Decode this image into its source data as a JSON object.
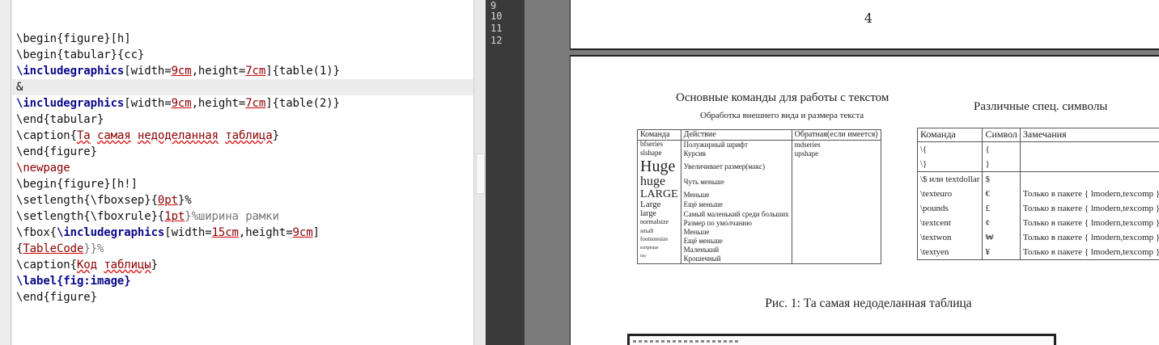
{
  "editor": {
    "lines": [
      [
        "\\begin{figure}[h]"
      ],
      [
        "\\begin{tabular}{cc}"
      ],
      [
        "\\includegraphics",
        "[width=",
        "9cm",
        ",height=",
        "7cm",
        "]{table(1)}"
      ],
      [
        "&"
      ],
      [
        "\\includegraphics",
        "[width=",
        "9cm",
        ",height=",
        "7cm",
        "]{table(2)}"
      ],
      [
        "\\end{tabular}"
      ],
      [
        "\\caption{",
        "Та",
        " ",
        "самая",
        " ",
        "недоделанная",
        " ",
        "таблица",
        "}"
      ],
      [
        "\\end{figure}"
      ],
      [
        "\\newpage"
      ],
      [
        "\\begin{figure}[h!]"
      ],
      [
        "\\setlength{\\fboxsep}{",
        "0pt",
        "}%"
      ],
      [
        "\\setlength{\\fboxrule}{",
        "1pt",
        "}%ширина рамки"
      ],
      [
        "\\fbox{",
        "\\includegraphics",
        "[width=",
        "15cm",
        ",height=",
        "9cm",
        "]"
      ],
      [
        "{",
        "TableCode",
        "}}%"
      ],
      [
        "\\caption{",
        "Код",
        " ",
        "таблицы",
        "}"
      ],
      [
        "\\label{fig:image}"
      ],
      [
        "\\end{figure}"
      ]
    ]
  },
  "console": {
    "line_numbers": [
      "9",
      "10",
      "11",
      "12"
    ]
  },
  "preview": {
    "page_number": "4",
    "table1": {
      "title": "Основные команды для работы с текстом",
      "subtitle": "Обработка внешнего вида и размера текста",
      "headers": [
        "Команда",
        "Действие",
        "Обратная(если имеется)"
      ],
      "rows": [
        [
          "bfseries",
          "Полужирный шрифт",
          "mdseries"
        ],
        [
          "slshape",
          "Курсив",
          "upshape"
        ],
        [
          "Huge",
          "Увеличивает размер(макс)",
          ""
        ],
        [
          "huge",
          "Чуть меньше",
          ""
        ],
        [
          "LARGE",
          "Меньше",
          ""
        ],
        [
          "Large",
          "Ещё меньше",
          ""
        ],
        [
          "large",
          "Самый маленький среди больших",
          ""
        ],
        [
          "normalsize",
          "Размер по умолчанию",
          ""
        ],
        [
          "small",
          "Меньше",
          ""
        ],
        [
          "footnotesize",
          "Ещё меньше",
          ""
        ],
        [
          "scriptsize",
          "Маленький",
          ""
        ],
        [
          "tiny",
          "Крошечный",
          ""
        ]
      ]
    },
    "table2": {
      "title": "Различные спец. символы",
      "headers": [
        "Команда",
        "Символ",
        "Замечания"
      ],
      "rows": [
        [
          "\\{",
          "{",
          ""
        ],
        [
          "\\}",
          "}",
          ""
        ],
        [
          "\\$ или textdollar",
          "$",
          ""
        ],
        [
          "\\texteuro",
          "€",
          "Только в пакете { lmodern,texcomp }"
        ],
        [
          "\\pounds",
          "£",
          "Только в пакете { lmodern,texcomp }"
        ],
        [
          "\\textcent",
          "¢",
          "Только в пакете { lmodern,texcomp }"
        ],
        [
          "\\textwon",
          "₩",
          "Только в пакете { lmodern,texcomp }"
        ],
        [
          "\\textyen",
          "¥",
          "Только в пакете { lmodern,texcomp }"
        ]
      ]
    },
    "caption": "Рис. 1: Та самая недоделанная таблица"
  }
}
